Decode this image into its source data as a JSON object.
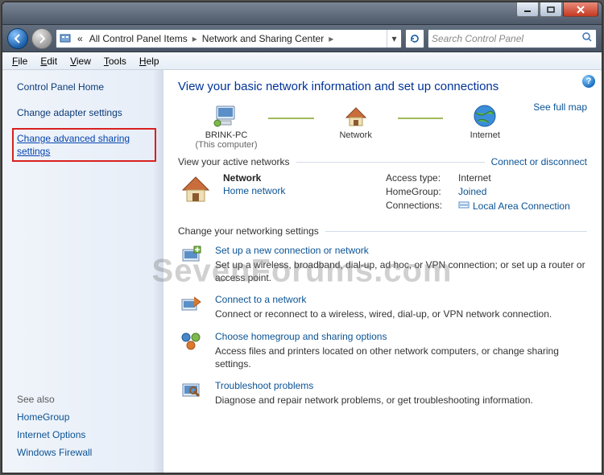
{
  "breadcrumb": {
    "root_prefix": "«",
    "item1": "All Control Panel Items",
    "item2": "Network and Sharing Center"
  },
  "search": {
    "placeholder": "Search Control Panel"
  },
  "menu": {
    "file": "File",
    "edit": "Edit",
    "view": "View",
    "tools": "Tools",
    "help": "Help"
  },
  "sidebar": {
    "home": "Control Panel Home",
    "adapter": "Change adapter settings",
    "advanced": "Change advanced sharing settings",
    "see_also_hdr": "See also",
    "homegroup": "HomeGroup",
    "internet_options": "Internet Options",
    "firewall": "Windows Firewall"
  },
  "main": {
    "title": "View your basic network information and set up connections",
    "see_full_map": "See full map",
    "map_node1": "BRINK-PC",
    "map_node1_sub": "(This computer)",
    "map_node2": "Network",
    "map_node3": "Internet",
    "active_hdr": "View your active networks",
    "connect_link": "Connect or disconnect",
    "net_name": "Network",
    "net_type": "Home network",
    "access_lbl": "Access type:",
    "access_val": "Internet",
    "homegroup_lbl": "HomeGroup:",
    "homegroup_val": "Joined",
    "conn_lbl": "Connections:",
    "conn_val": "Local Area Connection",
    "change_hdr": "Change your networking settings",
    "task1_link": "Set up a new connection or network",
    "task1_desc": "Set up a wireless, broadband, dial-up, ad hoc, or VPN connection; or set up a router or access point.",
    "task2_link": "Connect to a network",
    "task2_desc": "Connect or reconnect to a wireless, wired, dial-up, or VPN network connection.",
    "task3_link": "Choose homegroup and sharing options",
    "task3_desc": "Access files and printers located on other network computers, or change sharing settings.",
    "task4_link": "Troubleshoot problems",
    "task4_desc": "Diagnose and repair network problems, or get troubleshooting information."
  },
  "watermark": "SevenForums.com"
}
